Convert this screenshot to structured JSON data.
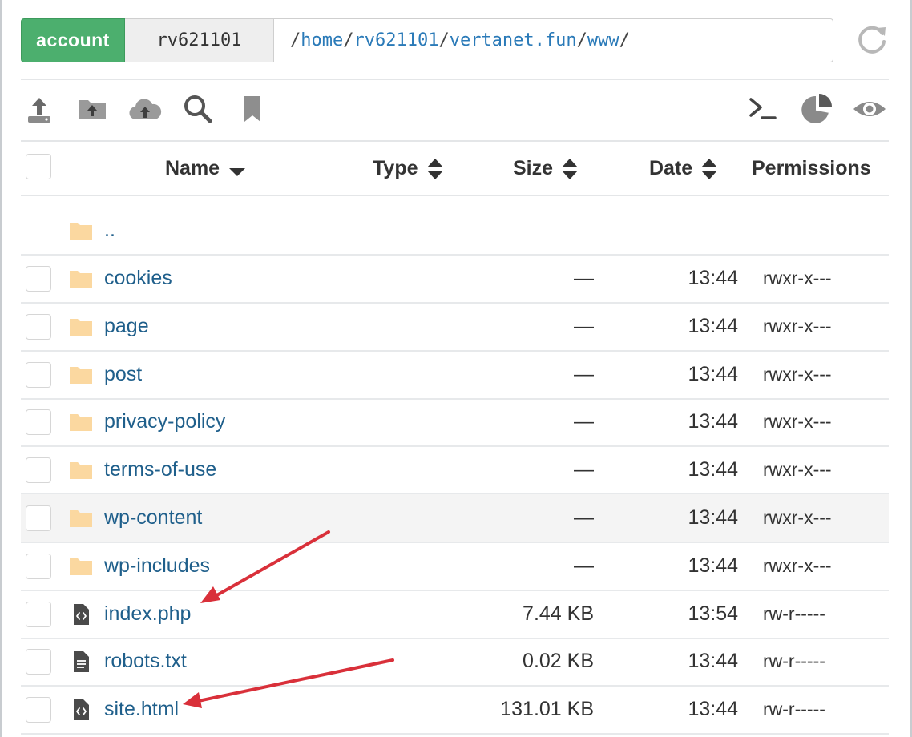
{
  "pathbar": {
    "account_label": "account",
    "user": "rv621101",
    "path_segments": [
      "home",
      "rv621101",
      "vertanet.fun",
      "www"
    ],
    "separator": "/"
  },
  "toolbar": {
    "left_icons": [
      "upload-icon",
      "upload-folder-icon",
      "cloud-upload-icon",
      "search-icon",
      "bookmark-icon"
    ],
    "right_icons": [
      "terminal-icon",
      "disk-usage-icon",
      "eye-icon"
    ]
  },
  "table": {
    "columns": {
      "name": "Name",
      "type": "Type",
      "size": "Size",
      "date": "Date",
      "permissions": "Permissions"
    },
    "parent_dir": "..",
    "rows": [
      {
        "name": "cookies",
        "kind": "folder",
        "size": "—",
        "date": "13:44",
        "perm": "rwxr-x---"
      },
      {
        "name": "page",
        "kind": "folder",
        "size": "—",
        "date": "13:44",
        "perm": "rwxr-x---"
      },
      {
        "name": "post",
        "kind": "folder",
        "size": "—",
        "date": "13:44",
        "perm": "rwxr-x---"
      },
      {
        "name": "privacy-policy",
        "kind": "folder",
        "size": "—",
        "date": "13:44",
        "perm": "rwxr-x---"
      },
      {
        "name": "terms-of-use",
        "kind": "folder",
        "size": "—",
        "date": "13:44",
        "perm": "rwxr-x---"
      },
      {
        "name": "wp-content",
        "kind": "folder",
        "size": "—",
        "date": "13:44",
        "perm": "rwxr-x---"
      },
      {
        "name": "wp-includes",
        "kind": "folder",
        "size": "—",
        "date": "13:44",
        "perm": "rwxr-x---"
      },
      {
        "name": "index.php",
        "kind": "code",
        "size": "7.44 KB",
        "date": "13:54",
        "perm": "rw-r-----"
      },
      {
        "name": "robots.txt",
        "kind": "text",
        "size": "0.02 KB",
        "date": "13:44",
        "perm": "rw-r-----"
      },
      {
        "name": "site.html",
        "kind": "code",
        "size": "131.01 KB",
        "date": "13:44",
        "perm": "rw-r-----"
      }
    ]
  },
  "colors": {
    "account_green": "#4caf6e",
    "link_blue": "#1f5f8b",
    "path_blue": "#2a7ab8",
    "folder": "#fbd8a0",
    "annotation_red": "#d9303a"
  }
}
